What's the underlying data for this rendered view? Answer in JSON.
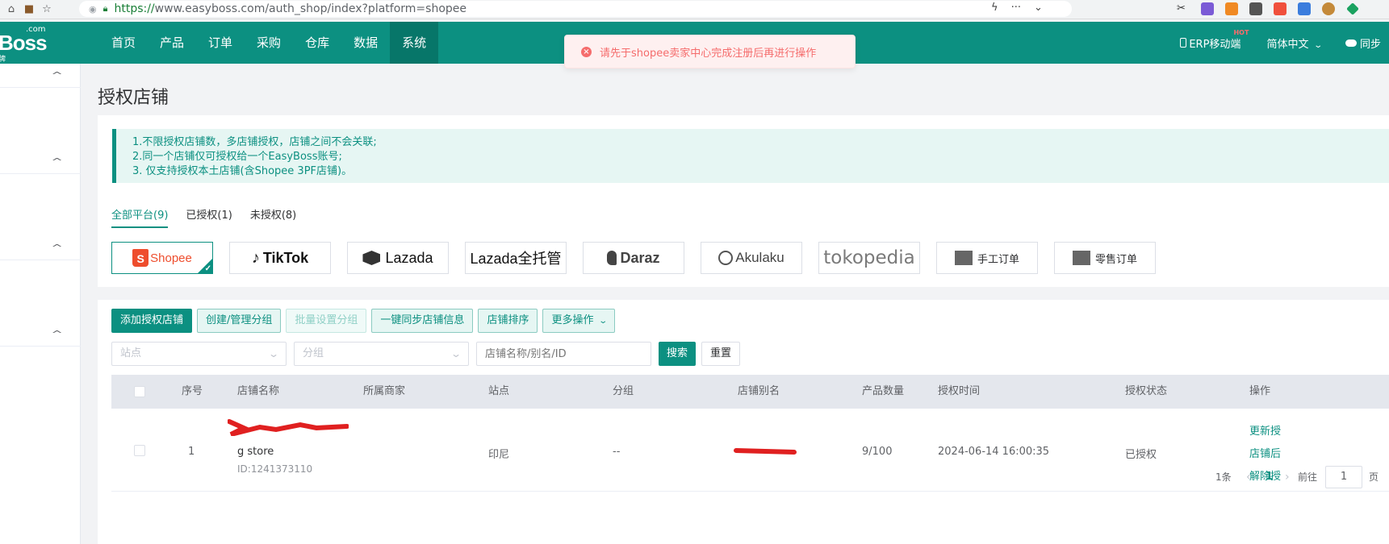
{
  "browser": {
    "url_https": "https://",
    "url_rest": "www.easyboss.com/auth_shop/index?platform=shopee"
  },
  "logo": {
    "com": ".com",
    "boss": "Boss",
    "sub": "牌"
  },
  "nav": {
    "items": [
      {
        "label": "首页"
      },
      {
        "label": "产品"
      },
      {
        "label": "订单"
      },
      {
        "label": "采购"
      },
      {
        "label": "仓库"
      },
      {
        "label": "数据"
      },
      {
        "label": "系统",
        "active": true
      }
    ],
    "mobile": "ERP移动端",
    "hot": "HOT",
    "language": "简体中文",
    "sync": "同步"
  },
  "toast": {
    "message": "请先于shopee卖家中心完成注册后再进行操作"
  },
  "page": {
    "title": "授权店铺"
  },
  "notice": {
    "lines": [
      "1.不限授权店铺数，多店铺授权，店铺之间不会关联;",
      "2.同一个店铺仅可授权给一个EasyBoss账号;",
      "3. 仅支持授权本土店铺(含Shopee 3PF店铺)。"
    ]
  },
  "tabs": [
    {
      "label": "全部平台(9)",
      "active": true
    },
    {
      "label": "已授权(1)"
    },
    {
      "label": "未授权(8)"
    }
  ],
  "platforms": {
    "shopee": "Shopee",
    "tiktok": "TikTok",
    "lazada": "Lazada",
    "lazada_full": "Lazada全托管",
    "daraz": "Daraz",
    "akulaku": "Akulaku",
    "tokopedia": "tokopedia",
    "manual": "手工订单",
    "retail": "零售订单"
  },
  "actions": {
    "add": "添加授权店铺",
    "manage_group": "创建/管理分组",
    "batch_group": "批量设置分组",
    "sync_all": "一键同步店铺信息",
    "sort": "店铺排序",
    "more": "更多操作"
  },
  "filters": {
    "site_placeholder": "站点",
    "group_placeholder": "分组",
    "name_placeholder": "店铺名称/别名/ID",
    "search": "搜索",
    "reset": "重置"
  },
  "table": {
    "headers": {
      "index": "序号",
      "name": "店铺名称",
      "merchant": "所属商家",
      "site": "站点",
      "group": "分组",
      "alias": "店铺别名",
      "products": "产品数量",
      "auth_time": "授权时间",
      "status": "授权状态",
      "ops": "操作"
    },
    "rows": [
      {
        "index": "1",
        "name": "g store",
        "id": "ID:1241373110",
        "site": "印尼",
        "group": "--",
        "products": "9/100",
        "auth_time": "2024-06-14 16:00:35",
        "status": "已授权",
        "op1": "更新授",
        "op2": "店铺后",
        "op3": "解除授"
      }
    ]
  },
  "pager": {
    "total": "1条",
    "current": "1",
    "goto": "前往",
    "page_value": "1",
    "page_suffix": "页"
  },
  "colors": {
    "brand": "#0c9081",
    "error": "#f56c6c",
    "redaction": "#e02020"
  }
}
